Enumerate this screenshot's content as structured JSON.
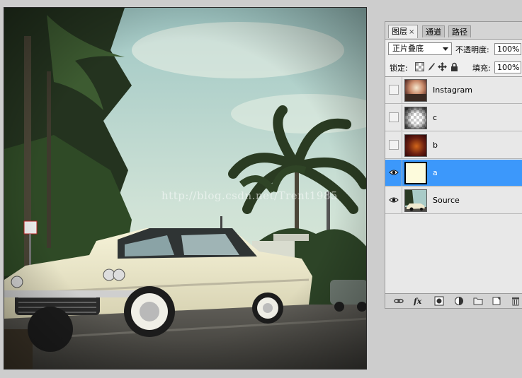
{
  "canvas": {
    "watermark": "http://blog.csdn.net/Trent1985"
  },
  "panel": {
    "tabs": [
      {
        "label": "图层",
        "close": "×",
        "active": true
      },
      {
        "label": "通道",
        "active": false
      },
      {
        "label": "路径",
        "active": false
      }
    ],
    "blend_mode": "正片叠底",
    "opacity_label": "不透明度:",
    "opacity_value": "100%",
    "lock_label": "锁定:",
    "fill_label": "填充:",
    "fill_value": "100%",
    "layers": [
      {
        "name": "Instagram",
        "visible": false,
        "selected": false,
        "thumb": "instagram-thumb"
      },
      {
        "name": "c",
        "visible": false,
        "selected": false,
        "thumb": "checker-thumb"
      },
      {
        "name": "b",
        "visible": false,
        "selected": false,
        "thumb": "radial-thumb"
      },
      {
        "name": "a",
        "visible": true,
        "selected": true,
        "thumb": "cream-thumb"
      },
      {
        "name": "Source",
        "visible": true,
        "selected": false,
        "thumb": "source-thumb"
      }
    ],
    "footer_icons": [
      "link-icon",
      "fx-icon",
      "mask-icon",
      "adjustment-icon",
      "folder-icon",
      "new-layer-icon",
      "trash-icon"
    ]
  },
  "colors": {
    "selection": "#3c98fb",
    "panel_bg": "#e8e8e8",
    "workspace_bg": "#cdcdcd"
  }
}
